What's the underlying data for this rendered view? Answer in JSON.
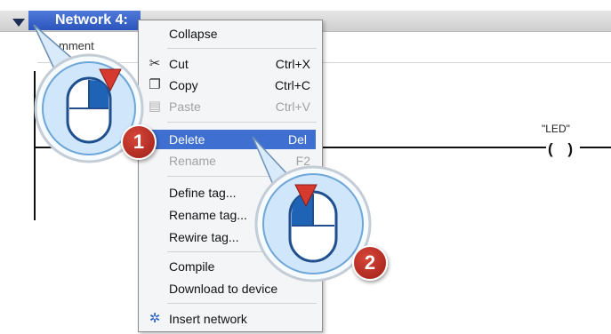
{
  "network": {
    "title": "Network 4:",
    "comment": "mment"
  },
  "ladder": {
    "coil_tag": "\"LED\"",
    "coil_symbol": "( )"
  },
  "context_menu": {
    "items": [
      {
        "label": "Collapse",
        "shortcut": "",
        "icon": "",
        "disabled": false,
        "selected": false
      },
      {
        "label": "Cut",
        "shortcut": "Ctrl+X",
        "icon": "scissors-icon",
        "disabled": false,
        "selected": false
      },
      {
        "label": "Copy",
        "shortcut": "Ctrl+C",
        "icon": "copy-icon",
        "disabled": false,
        "selected": false
      },
      {
        "label": "Paste",
        "shortcut": "Ctrl+V",
        "icon": "paste-icon",
        "disabled": true,
        "selected": false
      },
      {
        "label": "Delete",
        "shortcut": "Del",
        "icon": "",
        "disabled": false,
        "selected": true
      },
      {
        "label": "Rename",
        "shortcut": "F2",
        "icon": "",
        "disabled": true,
        "selected": false
      },
      {
        "label": "Define tag...",
        "shortcut": "",
        "icon": "",
        "disabled": false,
        "selected": false
      },
      {
        "label": "Rename tag...",
        "shortcut": "",
        "icon": "",
        "disabled": false,
        "selected": false
      },
      {
        "label": "Rewire tag...",
        "shortcut": "",
        "icon": "",
        "disabled": false,
        "selected": false
      },
      {
        "label": "Compile",
        "shortcut": "",
        "icon": "",
        "disabled": false,
        "selected": false
      },
      {
        "label": "Download to device",
        "shortcut": "",
        "icon": "",
        "disabled": false,
        "selected": false
      },
      {
        "label": "Insert network",
        "shortcut": "",
        "icon": "insert-network-icon",
        "disabled": false,
        "selected": false
      }
    ]
  },
  "callouts": [
    {
      "number": "1",
      "action": "right-click"
    },
    {
      "number": "2",
      "action": "left-click"
    }
  ],
  "colors": {
    "header_blue": "#2c55bd",
    "selection_blue": "#3f6fd0",
    "badge_red": "#b92b20",
    "callout_blue": "#cfe6fb"
  }
}
